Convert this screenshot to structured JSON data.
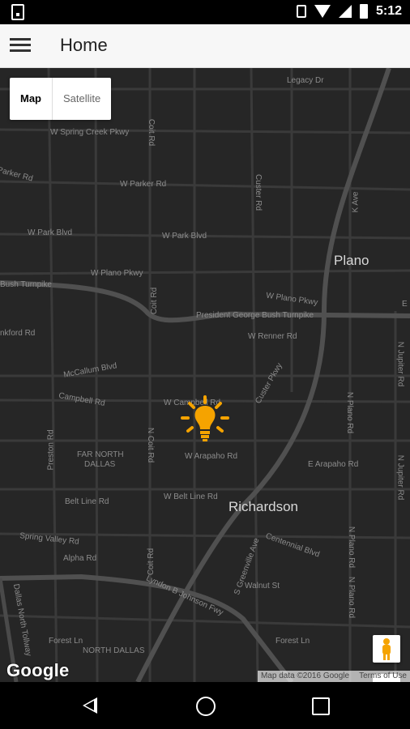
{
  "status_bar": {
    "time": "5:12"
  },
  "app_bar": {
    "title": "Home"
  },
  "map": {
    "type_control": {
      "map_label": "Map",
      "satellite_label": "Satellite",
      "selected": "Map"
    },
    "labels": {
      "legacy_dr": "Legacy Dr",
      "w_spring_creek_pkwy": "W Spring Creek Pkwy",
      "coit_rd_top": "Coit Rd",
      "w_parker_rd": "W Parker Rd",
      "parker_rd": "Parker Rd",
      "custer_rd": "Custer Rd",
      "k_ave": "K Ave",
      "w_park_blvd_left": "W Park Blvd",
      "w_park_blvd_center": "W Park Blvd",
      "plano": "Plano",
      "w_plano_pkwy_left": "W Plano Pkwy",
      "w_plano_pkwy_right": "W Plano Pkwy",
      "bush_turnpike_left": "Bush Turnpike",
      "coit_rd_mid": "Coit Rd",
      "president_bush_turnpike": "President George Bush Turnpike",
      "e_edge": "E",
      "frankford_rd": "nkford Rd",
      "w_renner_rd": "W Renner Rd",
      "n_jupiter_rd_top": "N Jupiter Rd",
      "mccallum_blvd": "McCallum Blvd",
      "custer_pkwy": "Custer Pkwy",
      "campbell_rd": "Campbell Rd",
      "w_campbell_rd": "W Campbell Rd",
      "n_plano_rd_top": "N Plano Rd",
      "preston_rd": "Preston Rd",
      "n_coit_rd": "N Coit Rd",
      "far_north_dallas_1": "FAR NORTH",
      "far_north_dallas_2": "DALLAS",
      "w_arapaho_rd": "W Arapaho Rd",
      "e_arapaho_rd": "E Arapaho Rd",
      "n_jupiter_rd_bottom": "N Jupiter Rd",
      "belt_line_rd": "Belt Line Rd",
      "w_belt_line_rd": "W Belt Line Rd",
      "richardson": "Richardson",
      "spring_valley_rd": "Spring Valley Rd",
      "centennial_blvd": "Centennial Blvd",
      "n_plano_rd_mid": "N Plano Rd",
      "alpha_rd": "Alpha Rd",
      "coit_rd_bottom": "Coit Rd",
      "s_greenville_ave": "S Greenville Ave",
      "lbj_fwy": "Lyndon B Johnson Fwy",
      "walnut_st": "Walnut St",
      "n_plano_rd_bottom": "N Plano Rd",
      "dallas_north_tollway": "Dallas North Tollway",
      "forest_ln_left": "Forest Ln",
      "forest_ln_right": "Forest Ln",
      "north_dallas": "NORTH DALLAS"
    },
    "marker_icon": "lightbulb-icon",
    "marker_color": "#f5a300",
    "zoom_in_label": "+",
    "zoom_out_label": "−",
    "logo": "Google",
    "attribution": "Map data ©2016 Google",
    "terms": "Terms of Use"
  }
}
